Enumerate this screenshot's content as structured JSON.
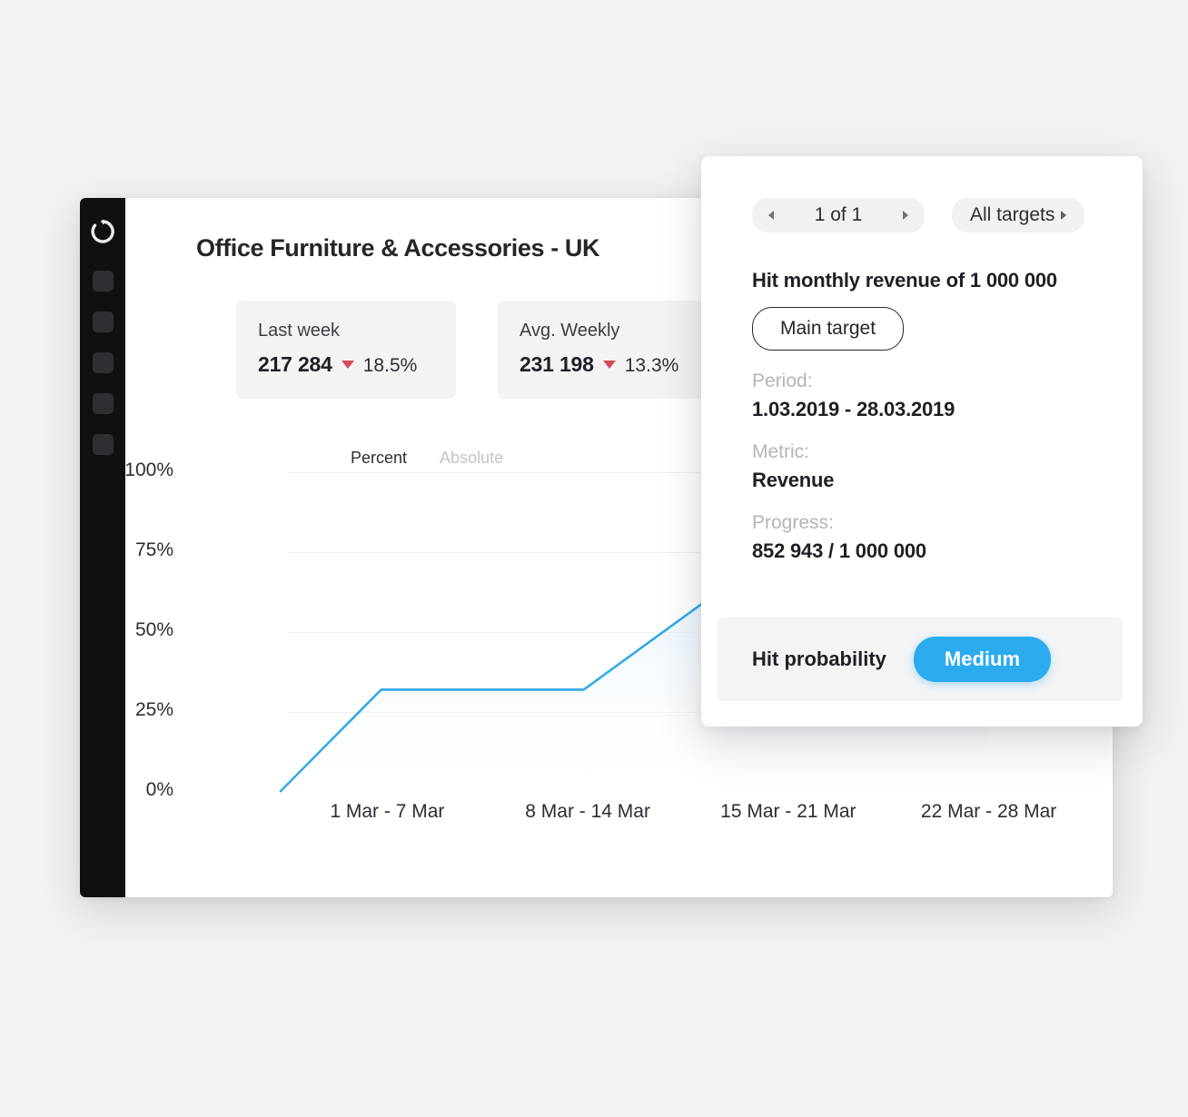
{
  "sidebar": {
    "logo_icon": "refresh-circle-icon",
    "items": [
      {
        "icon": "nav-square-icon-1"
      },
      {
        "icon": "nav-square-icon-2"
      },
      {
        "icon": "nav-square-icon-3"
      },
      {
        "icon": "nav-square-icon-4"
      },
      {
        "icon": "nav-square-icon-5"
      }
    ]
  },
  "header": {
    "title": "Office Furniture & Accessories - UK"
  },
  "stats": [
    {
      "label": "Last week",
      "value": "217 284",
      "trend": "down",
      "delta": "18.5%"
    },
    {
      "label": "Avg. Weekly",
      "value": "231 198",
      "trend": "down",
      "delta": "13.3%"
    }
  ],
  "chart_toggle": {
    "active": "Percent",
    "inactive": "Absolute"
  },
  "chart_data": {
    "type": "area",
    "title": "",
    "xlabel": "",
    "ylabel": "",
    "categories": [
      "1 Mar - 7 Mar",
      "8 Mar - 14 Mar",
      "15 Mar - 21 Mar",
      "22 Mar - 28 Mar"
    ],
    "values": [
      32,
      32,
      78,
      100
    ],
    "y_ticks": [
      "0%",
      "25%",
      "50%",
      "75%",
      "100%"
    ],
    "y_tick_values": [
      0,
      25,
      50,
      75,
      100
    ],
    "ylim": [
      0,
      100
    ],
    "origin_value": 0,
    "grid": true,
    "legend": "none",
    "line_color": "#30a8e8",
    "fill_top_color": "#cfe8fa",
    "fill_bottom_color": "#ffffff"
  },
  "panel": {
    "pager": {
      "prev_icon": "chevron-left-icon",
      "text": "1 of 1",
      "next_icon": "chevron-right-icon"
    },
    "all_targets": {
      "label": "All targets",
      "icon": "chevron-right-icon"
    },
    "title": "Hit monthly revenue of  1 000 000",
    "badge": "Main target",
    "fields": [
      {
        "label": "Period:",
        "value": "1.03.2019 - 28.03.2019"
      },
      {
        "label": "Metric:",
        "value": "Revenue"
      },
      {
        "label": "Progress:",
        "value": "852 943 / 1 000 000"
      }
    ],
    "footer": {
      "label": "Hit probability",
      "probability": "Medium",
      "probability_color": "#2babee"
    }
  }
}
